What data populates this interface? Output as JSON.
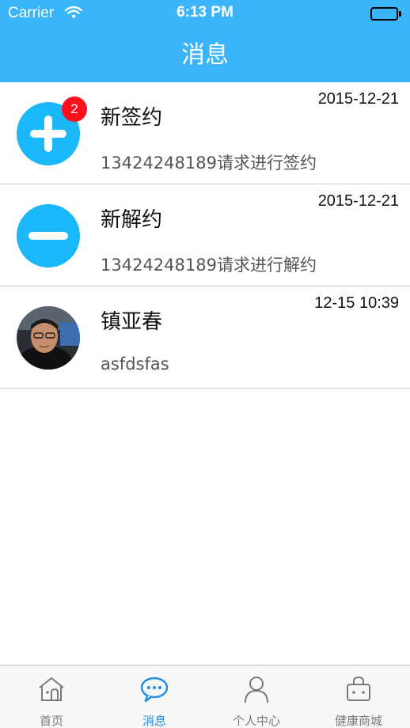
{
  "status_bar": {
    "carrier": "Carrier",
    "time": "6:13 PM"
  },
  "nav": {
    "title": "消息"
  },
  "messages": [
    {
      "title": "新签约",
      "subtitle": "13424248189请求进行签约",
      "time": "2015-12-21",
      "badge": "2",
      "icon": "plus-circle-icon"
    },
    {
      "title": "新解约",
      "subtitle": "13424248189请求进行解约",
      "time": "2015-12-21",
      "icon": "minus-circle-icon"
    },
    {
      "title": "镇亚春",
      "subtitle": "asfdsfas",
      "time": "12-15 10:39",
      "icon": "user-avatar"
    }
  ],
  "tabs": [
    {
      "label": "首页",
      "icon": "home-icon",
      "active": false
    },
    {
      "label": "消息",
      "icon": "chat-icon",
      "active": true
    },
    {
      "label": "个人中心",
      "icon": "person-icon",
      "active": false
    },
    {
      "label": "健康商城",
      "icon": "shopping-bag-icon",
      "active": false
    }
  ],
  "colors": {
    "header": "#3ab4fb",
    "icon_blue": "#1ab8f9",
    "badge": "#ff0f1c",
    "tab_active": "#1f8de3",
    "tab_inactive": "#7a7a7a"
  }
}
